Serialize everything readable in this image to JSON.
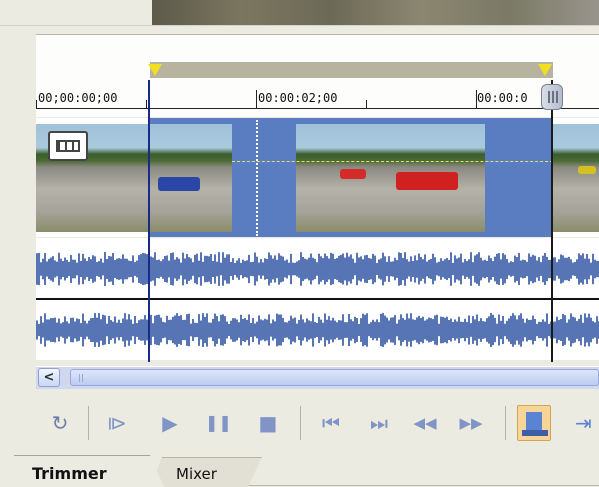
{
  "ruler": {
    "time_1": "00;00:00;00",
    "time_2": "00:00:02;00",
    "time_3": "00:00:0"
  },
  "scrollbar": {
    "left_arrow": "<"
  },
  "transport": {
    "buttons": [
      {
        "name": "loop-icon",
        "glyph": "↻"
      },
      {
        "name": "play-from-start-icon",
        "glyph": "⧐"
      },
      {
        "name": "play-icon",
        "glyph": "▶"
      },
      {
        "name": "pause-icon",
        "glyph": "❚❚"
      },
      {
        "name": "stop-icon",
        "glyph": "■"
      },
      {
        "name": "go-to-start-icon",
        "glyph": "⏮"
      },
      {
        "name": "go-to-end-icon",
        "glyph": "⏭"
      },
      {
        "name": "rewind-icon",
        "glyph": "◀◀"
      },
      {
        "name": "fast-forward-icon",
        "glyph": "▶▶"
      }
    ]
  },
  "tabs": {
    "trimmer": "Trimmer",
    "mixer": "Mixer",
    "active": "Trimmer"
  },
  "colors": {
    "selection": "#5a7cc1",
    "waveform": "#5774b5",
    "marker": "#f2e020",
    "region_bar": "#b7b39f"
  }
}
